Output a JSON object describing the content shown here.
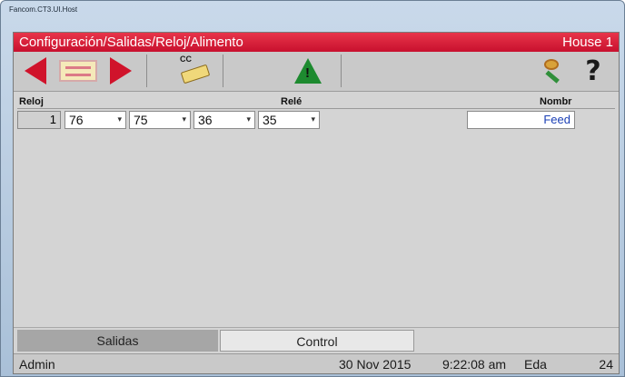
{
  "window": {
    "title": "Fancom.CT3.UI.Host"
  },
  "header": {
    "path": "Configuración/Salidas/Reloj/Alimento",
    "house": "House 1"
  },
  "toolbar": {
    "icons": [
      "arrow-left-icon",
      "list-icon",
      "arrow-right-icon",
      "card-icon",
      "warning-icon",
      "key-icon",
      "help-icon"
    ],
    "cc_label": "CC",
    "help_label": "?",
    "warning_label": "!"
  },
  "grid": {
    "columns": {
      "reloj": "Reloj",
      "rele": "Relé",
      "nombre": "Nombr"
    },
    "rows": [
      {
        "reloj": "1",
        "reles": [
          "76",
          "75",
          "36",
          "35"
        ],
        "nombre": "Feed"
      }
    ]
  },
  "tabs": [
    {
      "label": "Salidas",
      "active": true
    },
    {
      "label": "Control",
      "active": false
    }
  ],
  "status": {
    "user": "Admin",
    "date": "30 Nov 2015",
    "time": "9:22:08 am",
    "eda_label": "Eda",
    "eda_value": "24"
  },
  "colors": {
    "header": "#c8102e",
    "arrow": "#d0132b",
    "warning": "#1d8a2f",
    "name_text": "#1a3fb5"
  }
}
